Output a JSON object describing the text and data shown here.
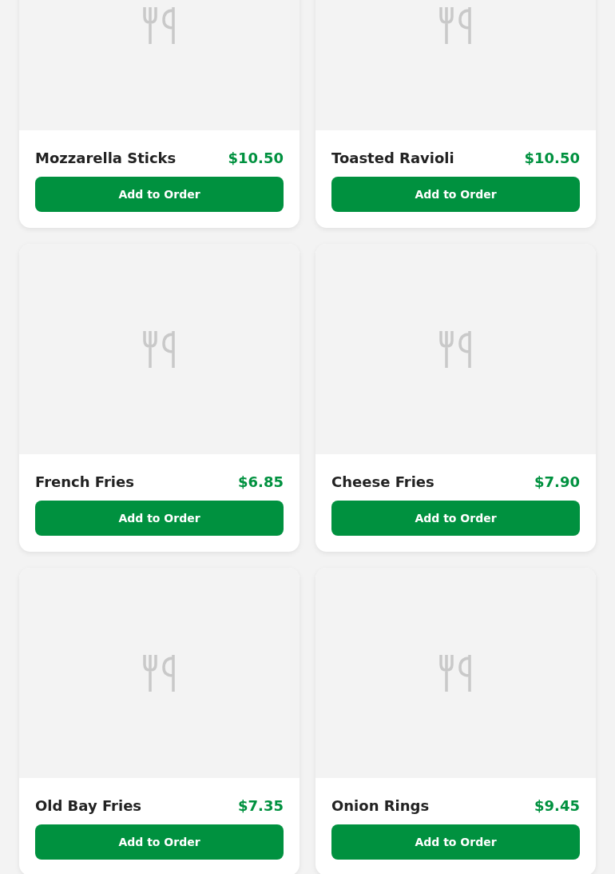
{
  "menu_items": [
    {
      "name": "Mozzarella Sticks",
      "price": "$10.50",
      "button": "Add to Order"
    },
    {
      "name": "Toasted Ravioli",
      "price": "$10.50",
      "button": "Add to Order"
    },
    {
      "name": "French Fries",
      "price": "$6.85",
      "button": "Add to Order"
    },
    {
      "name": "Cheese Fries",
      "price": "$7.90",
      "button": "Add to Order"
    },
    {
      "name": "Old Bay Fries",
      "price": "$7.35",
      "button": "Add to Order"
    },
    {
      "name": "Onion Rings",
      "price": "$9.45",
      "button": "Add to Order"
    }
  ]
}
